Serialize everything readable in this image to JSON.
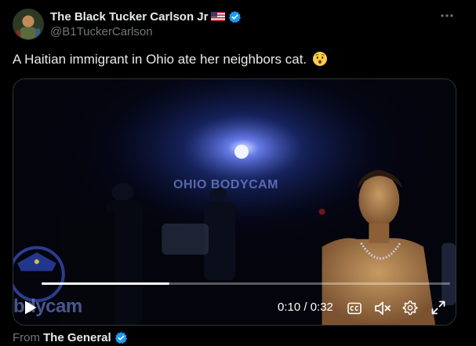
{
  "author": {
    "display_name": "The Black Tucker Carlson Jr",
    "handle": "@B1TuckerCarlson",
    "flag_icon": "us-flag-icon",
    "verified_icon": "verified-badge-icon",
    "verified_color": "#1d9bf0"
  },
  "menu": {
    "icon": "more-horizontal-icon"
  },
  "tweet": {
    "text": "A Haitian immigrant in Ohio ate her neighbors cat.",
    "emoji_icon": "hushed-face-emoji"
  },
  "video": {
    "watermark": "OHIO BODYCAM",
    "logo_text": "bdycam",
    "progress": 0.3125,
    "current_time": "0:10",
    "separator": "/",
    "duration": "0:32",
    "time_display": "0:10 / 0:32",
    "controls": {
      "play_icon": "play-icon",
      "captions_icon": "closed-captions-icon",
      "mute_icon": "muted-speaker-icon",
      "settings_icon": "settings-gear-icon",
      "fullscreen_icon": "fullscreen-icon"
    }
  },
  "source": {
    "label": "From",
    "name": "The General",
    "verified_icon": "verified-badge-icon"
  },
  "colors": {
    "background": "#000000",
    "text_primary": "#e7e9ea",
    "text_secondary": "#71767b",
    "accent": "#1d9bf0"
  }
}
